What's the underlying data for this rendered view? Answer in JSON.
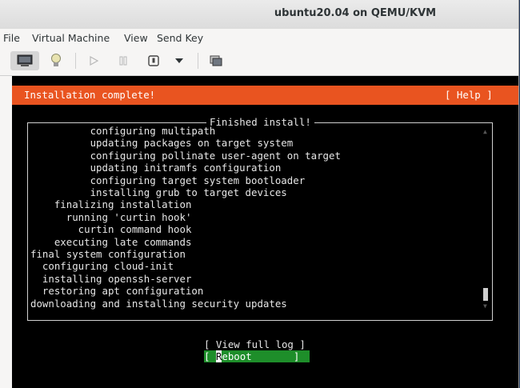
{
  "window": {
    "title": "ubuntu20.04 on QEMU/KVM"
  },
  "menu": [
    "File",
    "Virtual Machine",
    "View",
    "Send Key"
  ],
  "toolbar": {
    "icons": [
      "console-icon",
      "lightbulb-icon",
      "play-icon",
      "pause-icon",
      "power-icon",
      "dropdown-icon",
      "snapshot-icon"
    ]
  },
  "installer": {
    "banner_title": "Installation complete!",
    "help_label": "[ Help ]",
    "box_title": "Finished install!",
    "log_lines": [
      "          configuring multipath",
      "          updating packages on target system",
      "          configuring pollinate user-agent on target",
      "          updating initramfs configuration",
      "          configuring target system bootloader",
      "          installing grub to target devices",
      "    finalizing installation",
      "      running 'curtin hook'",
      "        curtin command hook",
      "    executing late commands",
      "final system configuration",
      "  configuring cloud-init",
      "  installing openssh-server",
      "  restoring apt configuration",
      "downloading and installing security updates"
    ],
    "view_log_label": "[ View full log ]",
    "reboot_left": "[ ",
    "reboot_cursor": "R",
    "reboot_rest": "eboot       ]"
  }
}
